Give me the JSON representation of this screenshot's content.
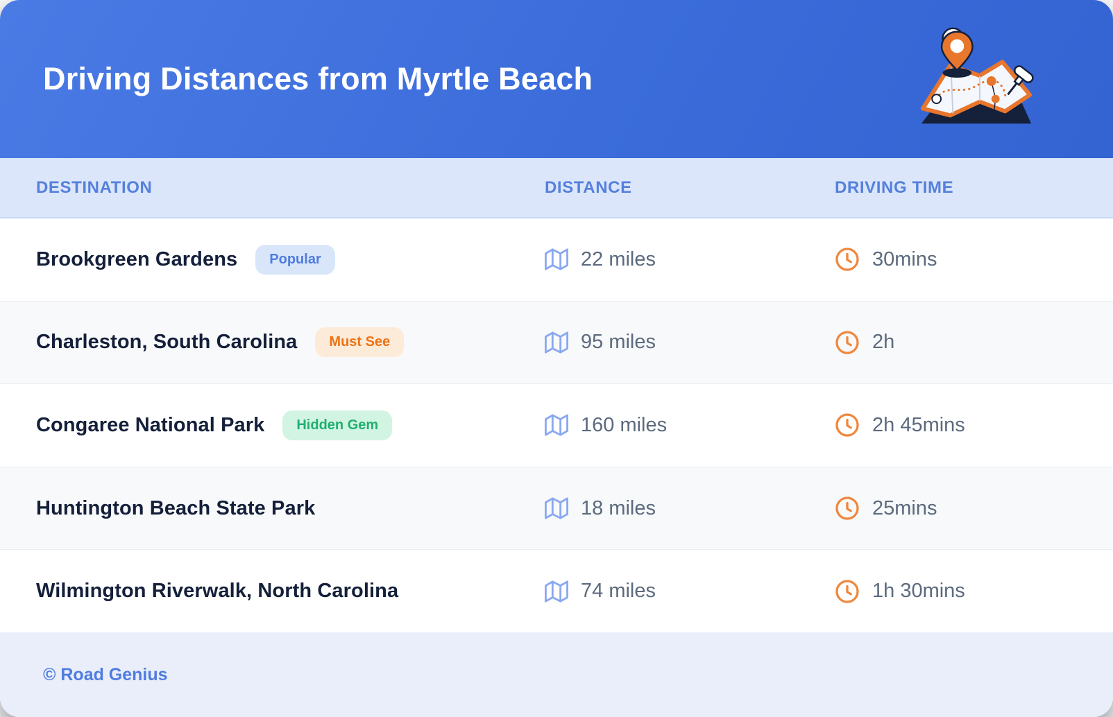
{
  "header": {
    "title": "Driving Distances from Myrtle Beach"
  },
  "table": {
    "columns": [
      {
        "key": "destination",
        "label": "DESTINATION"
      },
      {
        "key": "distance",
        "label": "DISTANCE"
      },
      {
        "key": "driving_time",
        "label": "DRIVING TIME"
      }
    ],
    "rows": [
      {
        "destination": "Brookgreen Gardens",
        "badge": {
          "label": "Popular",
          "type": "popular"
        },
        "distance": "22 miles",
        "driving_time": "30mins"
      },
      {
        "destination": "Charleston, South Carolina",
        "badge": {
          "label": "Must See",
          "type": "must-see"
        },
        "distance": "95 miles",
        "driving_time": "2h"
      },
      {
        "destination": "Congaree National Park",
        "badge": {
          "label": "Hidden Gem",
          "type": "hidden-gem"
        },
        "distance": "160 miles",
        "driving_time": "2h 45mins"
      },
      {
        "destination": "Huntington Beach State Park",
        "badge": null,
        "distance": "18 miles",
        "driving_time": "25mins"
      },
      {
        "destination": "Wilmington Riverwalk, North Carolina",
        "badge": null,
        "distance": "74 miles",
        "driving_time": "1h 30mins"
      }
    ]
  },
  "footer": {
    "credit": "© Road Genius"
  },
  "icons": {
    "distance": "map-icon",
    "driving_time": "clock-icon",
    "header": "map-route-illustration"
  },
  "colors": {
    "header_blue_start": "#4a7ae4",
    "header_blue_end": "#3463d2",
    "column_band_bg": "#dbe6fa",
    "column_label": "#5580dc",
    "row_alt_bg": "#f8f9fa",
    "destination_text": "#141f3a",
    "value_text": "#5c6a7d",
    "map_icon": "#8aa8f2",
    "clock_icon": "#f0873d",
    "badge_popular_bg": "#d9e6fa",
    "badge_popular_text": "#4f7ce0",
    "badge_must_see_bg": "#fdebd9",
    "badge_must_see_text": "#ee7211",
    "badge_hidden_gem_bg": "#d2f4e2",
    "badge_hidden_gem_text": "#1fb071",
    "footer_bg": "#e9eefa",
    "footer_text": "#4f7ce0",
    "illustration_orange": "#e8762c",
    "illustration_dark": "#15203a"
  }
}
